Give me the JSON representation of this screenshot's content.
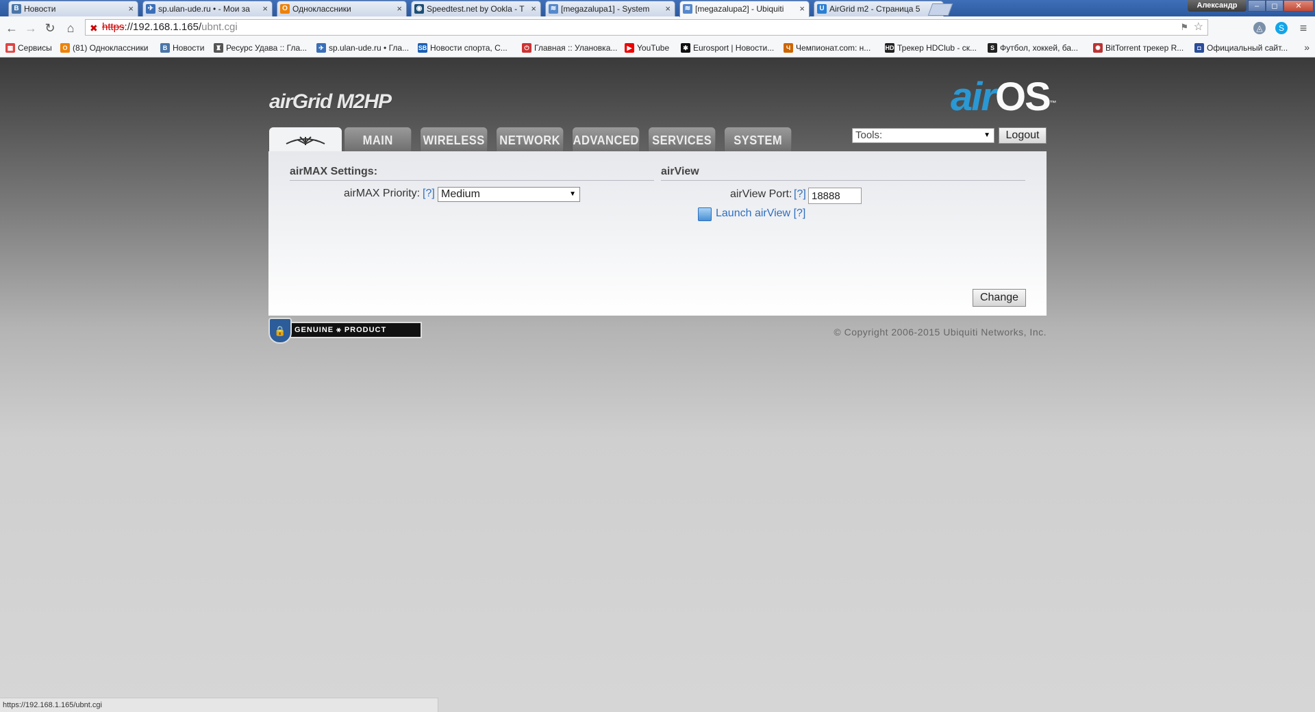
{
  "browser": {
    "tabs": [
      {
        "title": "Новости",
        "favicon": "vk-icon",
        "color": "#4a76a8",
        "glyph": "B",
        "active": false
      },
      {
        "title": "sp.ulan-ude.ru • - Мои за",
        "favicon": "cart-icon",
        "color": "#3a6fb8",
        "glyph": "✈",
        "active": false
      },
      {
        "title": "Одноклассники",
        "favicon": "ok-icon",
        "color": "#ee8208",
        "glyph": "О",
        "active": false
      },
      {
        "title": "Speedtest.net by Ookla - T",
        "favicon": "speedtest-icon",
        "color": "#1d4f75",
        "glyph": "◉",
        "active": false
      },
      {
        "title": "[megazalupa1] - System",
        "favicon": "wifi-icon",
        "color": "#5588cc",
        "glyph": "≋",
        "active": false
      },
      {
        "title": "[megazalupa2] - Ubiquiti",
        "favicon": "wifi-icon",
        "color": "#5588cc",
        "glyph": "≋",
        "active": true
      },
      {
        "title": "AirGrid m2 - Страница 5",
        "favicon": "ubnt-icon",
        "color": "#2a7fd4",
        "glyph": "U",
        "active": false
      }
    ],
    "user_name": "Александр",
    "window_controls": [
      "–",
      "◻",
      "✕"
    ],
    "url_scheme": "https",
    "url_host": "://192.168.1.165/",
    "url_path": "ubnt.cgi",
    "bookmarks": [
      {
        "label": "Сервисы",
        "color": "#d44",
        "glyph": "▦"
      },
      {
        "label": "(81) Одноклассники",
        "color": "#ee8208",
        "glyph": "О"
      },
      {
        "label": "Новости",
        "color": "#4a76a8",
        "glyph": "B"
      },
      {
        "label": "Ресурс Удава :: Гла...",
        "color": "#555",
        "glyph": "♜"
      },
      {
        "label": "sp.ulan-ude.ru • Гла...",
        "color": "#3a6fb8",
        "glyph": "✈"
      },
      {
        "label": "Новости спорта, С...",
        "color": "#1a5fb4",
        "glyph": "SB"
      },
      {
        "label": "Главная :: Улановка...",
        "color": "#c33",
        "glyph": "⏻"
      },
      {
        "label": "YouTube",
        "color": "#e00",
        "glyph": "▶"
      },
      {
        "label": "Eurosport | Новости...",
        "color": "#111",
        "glyph": "✱"
      },
      {
        "label": "Чемпионат.com: н...",
        "color": "#c60",
        "glyph": "Ч"
      },
      {
        "label": "Трекер HDClub - ск...",
        "color": "#222",
        "glyph": "HD"
      },
      {
        "label": "Футбол, хоккей, ба...",
        "color": "#222",
        "glyph": "S"
      },
      {
        "label": "BitTorrent трекер R...",
        "color": "#b33",
        "glyph": "✺"
      },
      {
        "label": "Официальный сайт...",
        "color": "#2a4d9a",
        "glyph": "◘"
      }
    ],
    "status_url": "https://192.168.1.165/ubnt.cgi"
  },
  "page": {
    "product_logo": "airGrid M2HP",
    "airos_logo_air": "air",
    "airos_logo_os": "OS",
    "airos_tm": "™",
    "nav_tabs": [
      "MAIN",
      "WIRELESS",
      "NETWORK",
      "ADVANCED",
      "SERVICES",
      "SYSTEM"
    ],
    "home_tab_icon": "ubiquiti-logo-icon",
    "tools_select": "Tools:",
    "logout_label": "Logout",
    "airmax": {
      "title": "airMAX Settings:",
      "priority_label": "airMAX Priority:",
      "help": "[?]",
      "priority_value": "Medium"
    },
    "airview": {
      "title": "airView",
      "port_label": "airView Port:",
      "help": "[?]",
      "port_value": "18888",
      "launch_label": "Launch airView",
      "launch_help": "[?]"
    },
    "change_label": "Change",
    "genuine_text": "GENUINE ⚹ PRODUCT",
    "copyright": "© Copyright 2006-2015 Ubiquiti Networks, Inc."
  }
}
